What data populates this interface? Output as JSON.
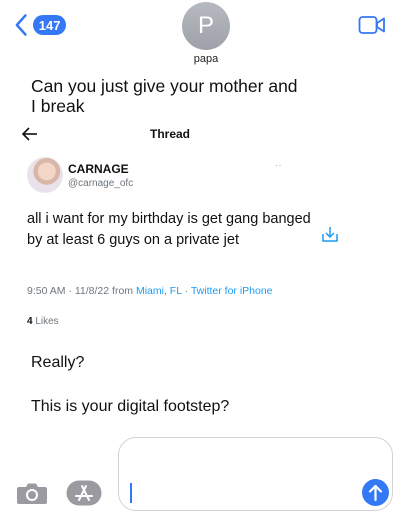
{
  "header": {
    "unread_count": "147",
    "avatar_initial": "P",
    "contact_name": "papa"
  },
  "messages": {
    "incoming_text": "Can you just give your mother and I break",
    "outgoing_1": "Really?",
    "outgoing_2": "This is your digital footstep?"
  },
  "tweet": {
    "thread_title": "Thread",
    "display_name": "CARNAGE",
    "handle": "@carnage_ofc",
    "text": "all i want for my birthday is get gang banged by at least 6 guys on a private jet",
    "time_date": "9:50 AM · 11/8/22 from ",
    "location": "Miami, FL",
    "separator": " · ",
    "source": "Twitter for iPhone",
    "likes_count": "4",
    "likes_label": " Likes"
  },
  "colors": {
    "ios_blue": "#3478f6",
    "twitter_blue": "#1d9bf0",
    "muted_gray": "#6e767d"
  },
  "icons": [
    "chevron-left-icon",
    "video-camera-icon",
    "arrow-left-icon",
    "share-icon",
    "camera-icon",
    "app-store-icon",
    "send-arrow-icon"
  ]
}
